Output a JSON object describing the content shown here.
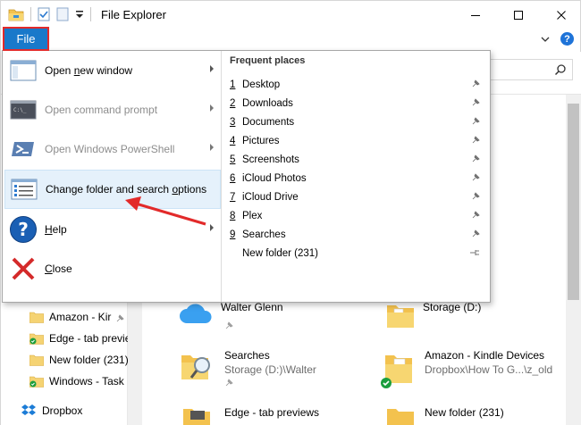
{
  "window": {
    "title": "File Explorer"
  },
  "ribbon": {
    "file_tab": "File",
    "help": "?"
  },
  "file_menu": {
    "items": [
      {
        "label": "Open new window",
        "key_char": "n",
        "pre": "Open ",
        "post": "ew window",
        "enabled": true,
        "submenu": true
      },
      {
        "label": "Open command prompt",
        "enabled": false,
        "submenu": true
      },
      {
        "label": "Open Windows PowerShell",
        "enabled": false,
        "submenu": true
      },
      {
        "label": "Change folder and search options",
        "pre": "Change folder and search ",
        "key_char": "o",
        "post": "ptions",
        "enabled": true,
        "submenu": false,
        "highlighted": true
      },
      {
        "label": "Help",
        "key_char": "H",
        "pre": "",
        "post": "elp",
        "enabled": true,
        "submenu": true
      },
      {
        "label": "Close",
        "key_char": "C",
        "pre": "",
        "post": "lose",
        "enabled": true,
        "submenu": false
      }
    ],
    "frequent_places": {
      "title": "Frequent places",
      "items": [
        {
          "num": "1",
          "name": "Desktop",
          "pinned": true
        },
        {
          "num": "2",
          "name": "Downloads",
          "pinned": true
        },
        {
          "num": "3",
          "name": "Documents",
          "pinned": true
        },
        {
          "num": "4",
          "name": "Pictures",
          "pinned": true
        },
        {
          "num": "5",
          "name": "Screenshots",
          "pinned": true
        },
        {
          "num": "6",
          "name": "iCloud Photos",
          "pinned": true
        },
        {
          "num": "7",
          "name": "iCloud Drive",
          "pinned": true
        },
        {
          "num": "8",
          "name": "Plex",
          "pinned": true
        },
        {
          "num": "9",
          "name": "Searches",
          "pinned": true
        },
        {
          "num": "",
          "name": "New folder (231)",
          "pinned": false
        }
      ]
    }
  },
  "nav_pane": {
    "items": [
      {
        "label": "Amazon - Kir",
        "pinned": true
      },
      {
        "label": "Edge - tab previe",
        "pinned": false
      },
      {
        "label": "New folder (231)",
        "pinned": false
      },
      {
        "label": "Windows - Task",
        "pinned": false
      },
      {
        "label": "Dropbox",
        "pinned": false
      }
    ]
  },
  "content": {
    "items": [
      {
        "name": "Walter Glenn",
        "sub": ""
      },
      {
        "name": "Storage (D:)",
        "sub": ""
      },
      {
        "name": "Searches",
        "sub": "Storage (D:)\\Walter"
      },
      {
        "name": "Amazon - Kindle Devices",
        "sub": "Dropbox\\How To G...\\z_old"
      },
      {
        "name": "Edge - tab previews",
        "sub": ""
      },
      {
        "name": "New folder (231)",
        "sub": ""
      }
    ]
  },
  "colors": {
    "file_tab_bg": "#1979ca",
    "highlight_bg": "#e5f1fb",
    "annotation_arrow": "#e22a2a"
  }
}
